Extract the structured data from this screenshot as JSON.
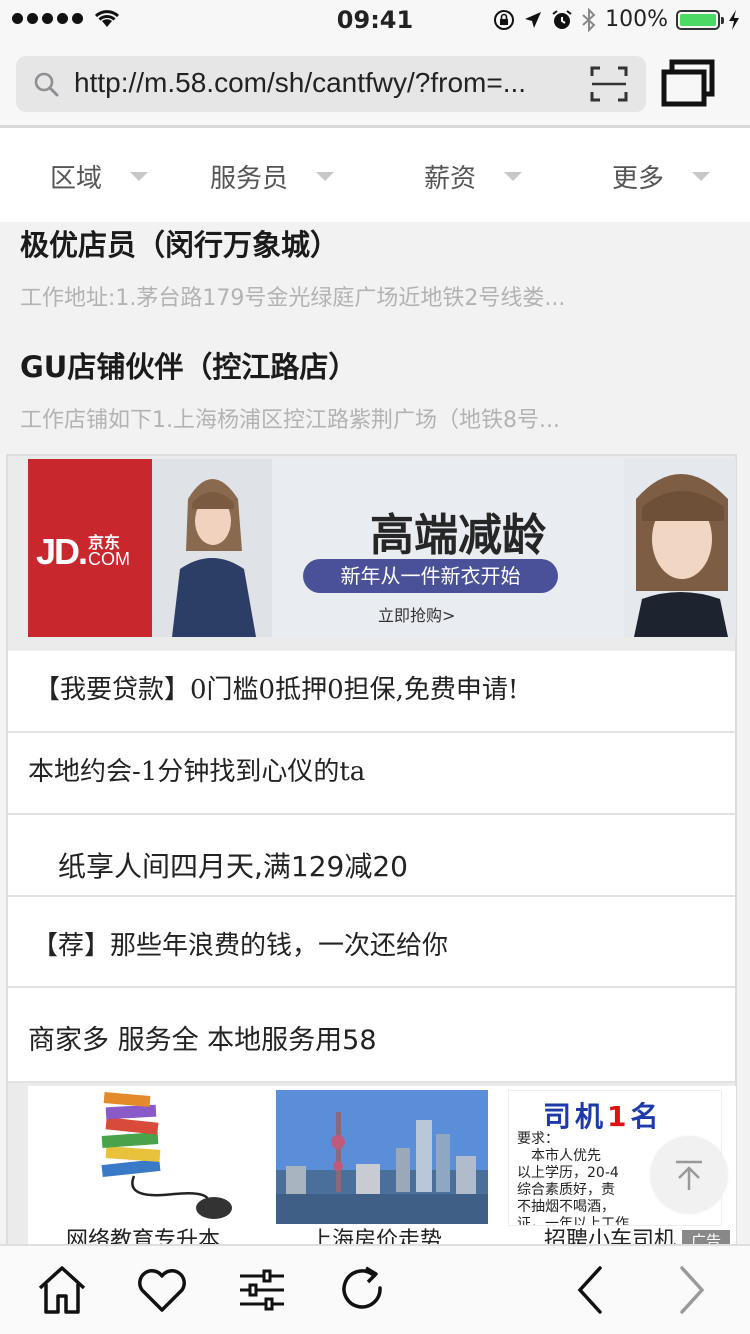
{
  "status_bar": {
    "time": "09:41",
    "battery": "100%"
  },
  "browser": {
    "url": "http://m.58.com/sh/cantfwy/?from=..."
  },
  "filters": [
    {
      "label": "区域"
    },
    {
      "label": "服务员"
    },
    {
      "label": "薪资"
    },
    {
      "label": "更多"
    }
  ],
  "jobs": [
    {
      "title": "极优店员（闵行万象城）",
      "desc": "工作地址:1.茅台路179号金光绿庭广场近地铁2号线娄..."
    },
    {
      "title": "GU店铺伙伴（控江路店）",
      "desc": "工作店铺如下1.上海杨浦区控江路紫荆广场（地铁8号..."
    }
  ],
  "banner": {
    "logo_jd": "JD.",
    "logo_cn": "京东",
    "logo_com": "COM",
    "headline": "高端减龄",
    "subline": "新年从一件新衣开始",
    "cta": "立即抢购>"
  },
  "text_ads": [
    "【我要贷款】0门槛0抵押0担保,免费申请!",
    "本地约会-1分钟找到心仪的ta",
    "纸享人间四月天,满129减20",
    "【荐】那些年浪费的钱，一次还给你",
    "商家多 服务全 本地服务用58"
  ],
  "thumb_ads": [
    {
      "caption": "网络教育专升本"
    },
    {
      "caption": "上海房价走势"
    },
    {
      "caption": "招聘小车司机",
      "heading_a": "司机",
      "heading_num": "1",
      "heading_b": "名",
      "body": "要求：\n　本市人优先\n以上学历，20-4\n综合素质好，责\n不抽烟不喝酒，\n证，一年以上工作"
    }
  ],
  "ad_tag": "广告",
  "colors": {
    "accent_green": "#4cd964",
    "jd_red": "#c8272e",
    "pill_blue": "#4a5199"
  }
}
